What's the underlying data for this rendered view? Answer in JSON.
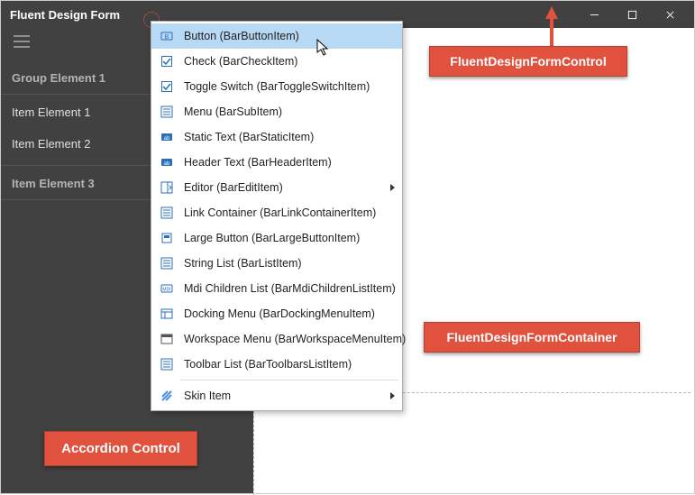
{
  "title": "Fluent Design Form",
  "sidebar": {
    "group1": "Group Element 1",
    "item1": "Item Element 1",
    "item2": "Item Element 2",
    "group2": "Item Element 3"
  },
  "callouts": {
    "accordion": "Accordion Control",
    "fcontrol": "FluentDesignFormControl",
    "fcontainer": "FluentDesignFormContainer"
  },
  "menu": {
    "i0": "Button (BarButtonItem)",
    "i1": "Check (BarCheckItem)",
    "i2": "Toggle Switch (BarToggleSwitchItem)",
    "i3": "Menu (BarSubItem)",
    "i4": "Static Text (BarStaticItem)",
    "i5": "Header Text (BarHeaderItem)",
    "i6": "Editor (BarEditItem)",
    "i7": "Link Container (BarLinkContainerItem)",
    "i8": "Large Button (BarLargeButtonItem)",
    "i9": "String List (BarListItem)",
    "i10": "Mdi Children List (BarMdiChildrenListItem)",
    "i11": "Docking Menu (BarDockingMenuItem)",
    "i12": "Workspace Menu (BarWorkspaceMenuItem)",
    "i13": "Toolbar List (BarToolbarsListItem)",
    "i14": "Skin Item"
  }
}
